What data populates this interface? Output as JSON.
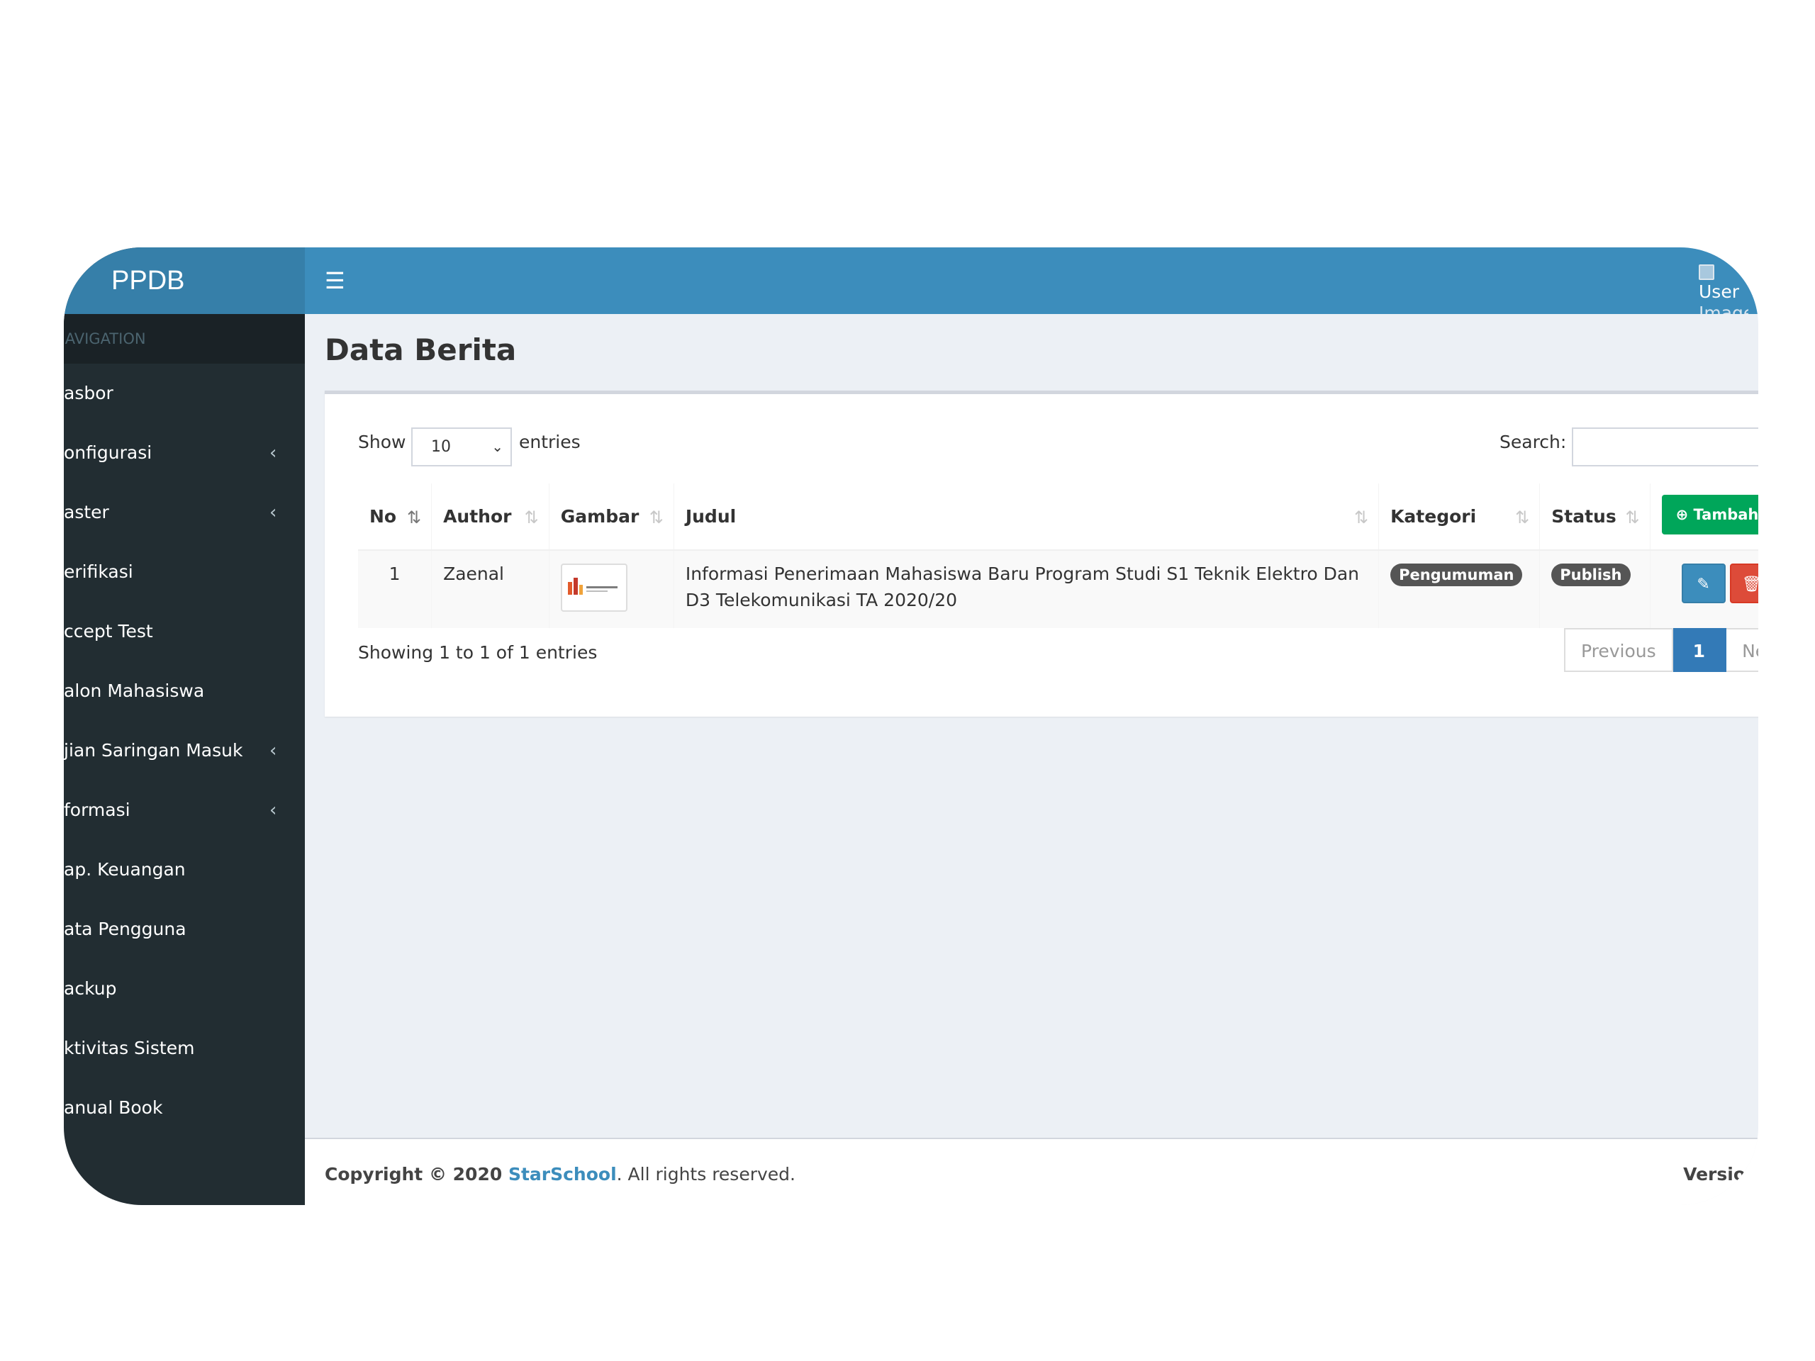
{
  "sidebar": {
    "logo": "PPDB",
    "nav_header": "NAVIGATION",
    "items": [
      {
        "label": "asbor",
        "has_children": false
      },
      {
        "label": "onfigurasi",
        "has_children": true
      },
      {
        "label": "aster",
        "has_children": true
      },
      {
        "label": "erifikasi",
        "has_children": false
      },
      {
        "label": "ccept Test",
        "has_children": false
      },
      {
        "label": "alon Mahasiswa",
        "has_children": false
      },
      {
        "label": "jian Saringan Masuk",
        "has_children": true
      },
      {
        "label": "formasi",
        "has_children": true
      },
      {
        "label": "ap. Keuangan",
        "has_children": false
      },
      {
        "label": "ata Pengguna",
        "has_children": false
      },
      {
        "label": "ackup",
        "has_children": false
      },
      {
        "label": "ktivitas Sistem",
        "has_children": false
      },
      {
        "label": "anual Book",
        "has_children": false
      }
    ],
    "chevron_icon": "chevron-left-icon"
  },
  "topbar": {
    "toggle_icon": "hamburger-menu-icon",
    "user_image_alt_1": "User",
    "user_image_alt_2": "Image"
  },
  "page": {
    "title": "Data Berita",
    "show_label": "Show",
    "length_value": "10",
    "entries_label": "entries",
    "search_label": "Search:",
    "search_value": ""
  },
  "table": {
    "columns": [
      "No",
      "Author",
      "Gambar",
      "Judul",
      "Kategori",
      "Status"
    ],
    "add_button": "Tambah",
    "rows": [
      {
        "no": "1",
        "author": "Zaenal",
        "judul": "Informasi Penerimaan Mahasiswa Baru Program Studi S1 Teknik Elektro Dan D3 Telekomunikasi TA 2020/20",
        "kategori": "Pengumuman",
        "status": "Publish"
      }
    ],
    "info": "Showing 1 to 1 of 1 entries",
    "pager": {
      "previous": "Previous",
      "current": "1",
      "next": "Next"
    }
  },
  "footer": {
    "copyright_prefix": "Copyright © 2020 ",
    "brand": "StarSchool",
    "copyright_suffix": ". All rights reserved.",
    "version": "Versio"
  },
  "colors": {
    "header": "#3c8dbc",
    "logo": "#367fa9",
    "sidebar": "#222d32",
    "success": "#00a65a",
    "danger": "#dd4b39"
  }
}
